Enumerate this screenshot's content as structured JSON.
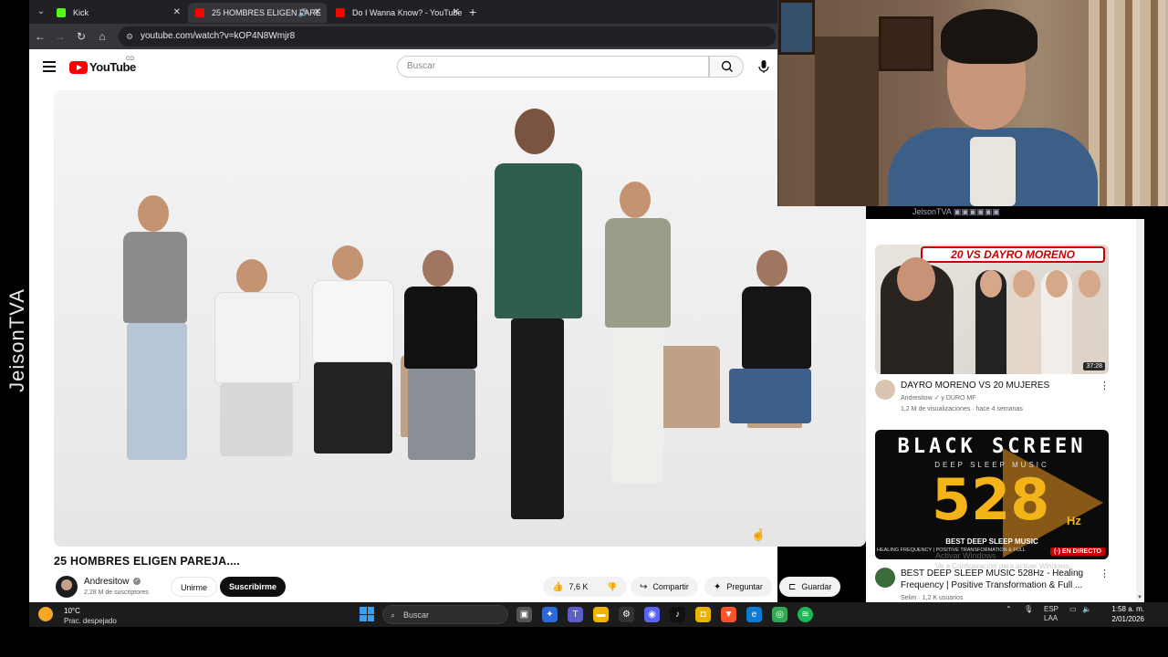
{
  "watermark": "JeisonTVA",
  "browser": {
    "tabs": [
      {
        "label": "Kick",
        "favicon_color": "#53fc18",
        "active": false
      },
      {
        "label": "25 HOMBRES ELIGEN PARE",
        "favicon_color": "#ff0000",
        "active": true
      },
      {
        "label": "Do I Wanna Know? - YouTube",
        "favicon_color": "#ff0000",
        "active": false
      }
    ],
    "url": "youtube.com/watch?v=kOP4N8Wmjr8"
  },
  "youtube": {
    "logo_text": "YouTube",
    "country_code": "CO",
    "search_placeholder": "Buscar"
  },
  "video": {
    "title": "25 HOMBRES ELIGEN PAREJA....",
    "channel_name": "Andresitow",
    "subscribers": "2,28 M de suscriptores",
    "join_label": "Unirme",
    "subscribe_label": "Suscribirme",
    "likes": "7,6 K",
    "share_label": "Compartir",
    "ask_label": "Preguntar",
    "save_label": "Guardar"
  },
  "stream_overlay": {
    "social_strip": "JeisonTVA"
  },
  "recommendations": [
    {
      "title": "DAYRO MORENO VS 20 MUJERES",
      "channel": "Andresitow ✓ y DURO MF",
      "meta": "1,2 M de visualizaciones · hace 4 semanas",
      "duration": "37:28",
      "thumb_banner": "20 VS DAYRO MORENO"
    },
    {
      "title": "BEST DEEP SLEEP MUSIC 528Hz - Healing Frequency | Positive Transformation & Full ...",
      "meta": "Selim · 1,2 K usuarios",
      "live_badge": "EN DIRECTO",
      "thumb_line1": "BLACK SCREEN",
      "thumb_line2": "DEEP SLEEP MUSIC",
      "thumb_number": "528",
      "thumb_unit": "Hz",
      "thumb_line3": "BEST DEEP SLEEP MUSIC",
      "thumb_line4": "HEALING FREQUENCY | POSITIVE TRANSFORMATION & FULL"
    }
  ],
  "windows_watermark": {
    "line1": "Activar Windows",
    "line2": "Ve a Configuración para activar Windows."
  },
  "taskbar": {
    "temperature": "10°C",
    "weather": "Prac. despejado",
    "search_placeholder": "Buscar",
    "language": "ESP",
    "layout": "LAA",
    "time": "1:58 a. m.",
    "date": "2/01/2026"
  },
  "colors": {
    "youtube_red": "#ff0000",
    "browser_dark": "#202124",
    "taskbar": "#1c1c1c"
  }
}
